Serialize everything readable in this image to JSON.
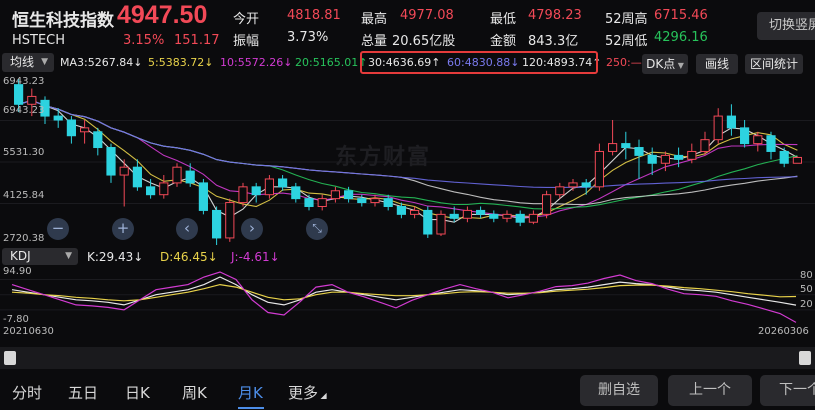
{
  "header": {
    "name": "恒生科技指数",
    "code": "HSTECH",
    "price": "4947.50",
    "change_pct": "3.15%",
    "change_val": "151.17",
    "fields": [
      {
        "label": "今开",
        "value": "4818.81",
        "tone": "red"
      },
      {
        "label": "振幅",
        "value": "3.73%",
        "tone": "white"
      },
      {
        "label": "最高",
        "value": "4977.08",
        "tone": "red"
      },
      {
        "label": "总量",
        "value": "20.65亿股",
        "tone": "white"
      },
      {
        "label": "最低",
        "value": "4798.23",
        "tone": "red"
      },
      {
        "label": "金额",
        "value": "843.3亿",
        "tone": "white"
      },
      {
        "label": "52周高",
        "value": "6715.46",
        "tone": "red"
      },
      {
        "label": "52周低",
        "value": "4296.16",
        "tone": "green"
      }
    ],
    "switch_label": "切换竖屏"
  },
  "ma_bar": {
    "selector": "均线",
    "items": [
      "MA3:5267.84↓",
      "5:5383.72↓",
      "10:5572.26↓",
      "20:5165.01↑",
      "30:4636.69↑",
      "60:4830.88↓",
      "120:4893.74↑",
      "250:—"
    ],
    "colors": {
      "ma3": "#e8e8e8",
      "ma5": "#e8d24a",
      "ma10": "#d23bd2",
      "ma20": "#27c35b",
      "ma30": "#e8e8e8",
      "ma60": "#6a6ae8",
      "ma120": "#e8e8e8",
      "ma250": "#f24957"
    },
    "dk_label": "DK点",
    "draw_label": "画线",
    "range_label": "区间统计"
  },
  "price_axis": [
    "6943.23",
    "5531.30",
    "4125.84",
    "2720.38"
  ],
  "watermark": "东方财富",
  "controls": {
    "minus": "−",
    "plus": "+",
    "left": "‹",
    "right": "›"
  },
  "kdj": {
    "selector": "KDJ",
    "k": "K:29.43↓",
    "d": "D:46.45↓",
    "j": "J:-4.61↓",
    "axis": [
      "94.90",
      "-7.80"
    ],
    "right_axis": [
      "80",
      "50",
      "20"
    ],
    "date_start": "20210630",
    "date_end": "20260306"
  },
  "tabs": [
    {
      "label": "分时",
      "active": false
    },
    {
      "label": "五日",
      "active": false
    },
    {
      "label": "日K",
      "active": false
    },
    {
      "label": "周K",
      "active": false
    },
    {
      "label": "月K",
      "active": true
    },
    {
      "label": "更多",
      "active": false
    }
  ],
  "buttons": {
    "remove_fav": "删自选",
    "prev": "上一个",
    "next": "下一个"
  },
  "chart_data": {
    "type": "candlestick",
    "period": "monthly",
    "ylim": [
      2720.38,
      6943.23
    ],
    "candles": [
      {
        "o": 6800,
        "c": 6300,
        "h": 6943,
        "l": 6100
      },
      {
        "o": 6300,
        "c": 6500,
        "h": 6700,
        "l": 6000
      },
      {
        "o": 6400,
        "c": 6000,
        "h": 6500,
        "l": 5800
      },
      {
        "o": 6000,
        "c": 5900,
        "h": 6200,
        "l": 5700
      },
      {
        "o": 5900,
        "c": 5500,
        "h": 6000,
        "l": 5300
      },
      {
        "o": 5600,
        "c": 5700,
        "h": 5900,
        "l": 5300
      },
      {
        "o": 5600,
        "c": 5200,
        "h": 5700,
        "l": 5000
      },
      {
        "o": 5200,
        "c": 4500,
        "h": 5300,
        "l": 4300
      },
      {
        "o": 4500,
        "c": 4700,
        "h": 4900,
        "l": 3700
      },
      {
        "o": 4700,
        "c": 4200,
        "h": 4900,
        "l": 4100
      },
      {
        "o": 4200,
        "c": 4000,
        "h": 4400,
        "l": 3900
      },
      {
        "o": 4000,
        "c": 4300,
        "h": 4500,
        "l": 3900
      },
      {
        "o": 4300,
        "c": 4700,
        "h": 4800,
        "l": 4200
      },
      {
        "o": 4600,
        "c": 4300,
        "h": 4800,
        "l": 4200
      },
      {
        "o": 4300,
        "c": 3600,
        "h": 4400,
        "l": 3500
      },
      {
        "o": 3600,
        "c": 2900,
        "h": 3700,
        "l": 2720
      },
      {
        "o": 2900,
        "c": 3800,
        "h": 3900,
        "l": 2800
      },
      {
        "o": 3800,
        "c": 4200,
        "h": 4300,
        "l": 3700
      },
      {
        "o": 4200,
        "c": 4000,
        "h": 4300,
        "l": 3800
      },
      {
        "o": 4000,
        "c": 4400,
        "h": 4500,
        "l": 3900
      },
      {
        "o": 4400,
        "c": 4200,
        "h": 4500,
        "l": 4100
      },
      {
        "o": 4200,
        "c": 3900,
        "h": 4300,
        "l": 3800
      },
      {
        "o": 3900,
        "c": 3700,
        "h": 4000,
        "l": 3600
      },
      {
        "o": 3700,
        "c": 3900,
        "h": 4000,
        "l": 3600
      },
      {
        "o": 3900,
        "c": 4100,
        "h": 4200,
        "l": 3800
      },
      {
        "o": 4100,
        "c": 3900,
        "h": 4200,
        "l": 3800
      },
      {
        "o": 3900,
        "c": 3800,
        "h": 4000,
        "l": 3700
      },
      {
        "o": 3800,
        "c": 3900,
        "h": 4000,
        "l": 3700
      },
      {
        "o": 3900,
        "c": 3700,
        "h": 4000,
        "l": 3600
      },
      {
        "o": 3700,
        "c": 3500,
        "h": 3800,
        "l": 3400
      },
      {
        "o": 3500,
        "c": 3600,
        "h": 3700,
        "l": 3400
      },
      {
        "o": 3600,
        "c": 3000,
        "h": 3700,
        "l": 2900
      },
      {
        "o": 3000,
        "c": 3500,
        "h": 3600,
        "l": 2950
      },
      {
        "o": 3500,
        "c": 3400,
        "h": 3700,
        "l": 3300
      },
      {
        "o": 3400,
        "c": 3600,
        "h": 3700,
        "l": 3300
      },
      {
        "o": 3600,
        "c": 3500,
        "h": 3700,
        "l": 3400
      },
      {
        "o": 3500,
        "c": 3400,
        "h": 3600,
        "l": 3300
      },
      {
        "o": 3400,
        "c": 3500,
        "h": 3600,
        "l": 3300
      },
      {
        "o": 3500,
        "c": 3300,
        "h": 3600,
        "l": 3200
      },
      {
        "o": 3300,
        "c": 3500,
        "h": 3600,
        "l": 3250
      },
      {
        "o": 3500,
        "c": 4000,
        "h": 4100,
        "l": 3400
      },
      {
        "o": 4000,
        "c": 4200,
        "h": 4300,
        "l": 3900
      },
      {
        "o": 4200,
        "c": 4300,
        "h": 4400,
        "l": 4100
      },
      {
        "o": 4300,
        "c": 4200,
        "h": 4400,
        "l": 4000
      },
      {
        "o": 4200,
        "c": 5100,
        "h": 5300,
        "l": 4100
      },
      {
        "o": 5100,
        "c": 5300,
        "h": 5900,
        "l": 5000
      },
      {
        "o": 5300,
        "c": 5200,
        "h": 5600,
        "l": 4900
      },
      {
        "o": 5200,
        "c": 5000,
        "h": 5400,
        "l": 4400
      },
      {
        "o": 5000,
        "c": 4800,
        "h": 5200,
        "l": 4500
      },
      {
        "o": 4800,
        "c": 5000,
        "h": 5100,
        "l": 4600
      },
      {
        "o": 5000,
        "c": 4900,
        "h": 5200,
        "l": 4700
      },
      {
        "o": 4900,
        "c": 5100,
        "h": 5300,
        "l": 4800
      },
      {
        "o": 5100,
        "c": 5400,
        "h": 5600,
        "l": 5000
      },
      {
        "o": 5400,
        "c": 6000,
        "h": 6200,
        "l": 5300
      },
      {
        "o": 6000,
        "c": 5700,
        "h": 6300,
        "l": 5500
      },
      {
        "o": 5700,
        "c": 5300,
        "h": 5900,
        "l": 5200
      },
      {
        "o": 5300,
        "c": 5500,
        "h": 5600,
        "l": 5100
      },
      {
        "o": 5500,
        "c": 5100,
        "h": 5600,
        "l": 4900
      },
      {
        "o": 5100,
        "c": 4800,
        "h": 5200,
        "l": 4700
      },
      {
        "o": 4800,
        "c": 4947.5,
        "h": 4977,
        "l": 4798
      }
    ],
    "kdj_series": {
      "K": [
        60,
        55,
        50,
        45,
        40,
        38,
        35,
        30,
        40,
        50,
        55,
        60,
        70,
        85,
        70,
        50,
        35,
        30,
        40,
        55,
        60,
        55,
        50,
        45,
        40,
        45,
        50,
        55,
        60,
        58,
        55,
        50,
        52,
        55,
        60,
        62,
        65,
        70,
        75,
        72,
        70,
        65,
        60,
        58,
        55,
        50,
        45,
        40,
        35,
        29.43
      ],
      "D": [
        55,
        53,
        50,
        48,
        45,
        43,
        40,
        38,
        40,
        45,
        50,
        55,
        62,
        70,
        65,
        55,
        45,
        40,
        42,
        50,
        55,
        55,
        52,
        50,
        48,
        48,
        50,
        52,
        55,
        56,
        55,
        53,
        53,
        54,
        57,
        59,
        61,
        64,
        68,
        69,
        69,
        67,
        64,
        62,
        59,
        56,
        52,
        49,
        46,
        46.45
      ],
      "J": [
        70,
        60,
        50,
        40,
        30,
        28,
        25,
        20,
        40,
        60,
        65,
        70,
        85,
        94.9,
        80,
        40,
        15,
        10,
        36,
        65,
        70,
        55,
        46,
        35,
        24,
        39,
        50,
        61,
        70,
        62,
        55,
        44,
        50,
        57,
        66,
        68,
        73,
        82,
        89,
        78,
        72,
        61,
        52,
        50,
        47,
        38,
        31,
        22,
        13,
        -4.61
      ]
    }
  }
}
